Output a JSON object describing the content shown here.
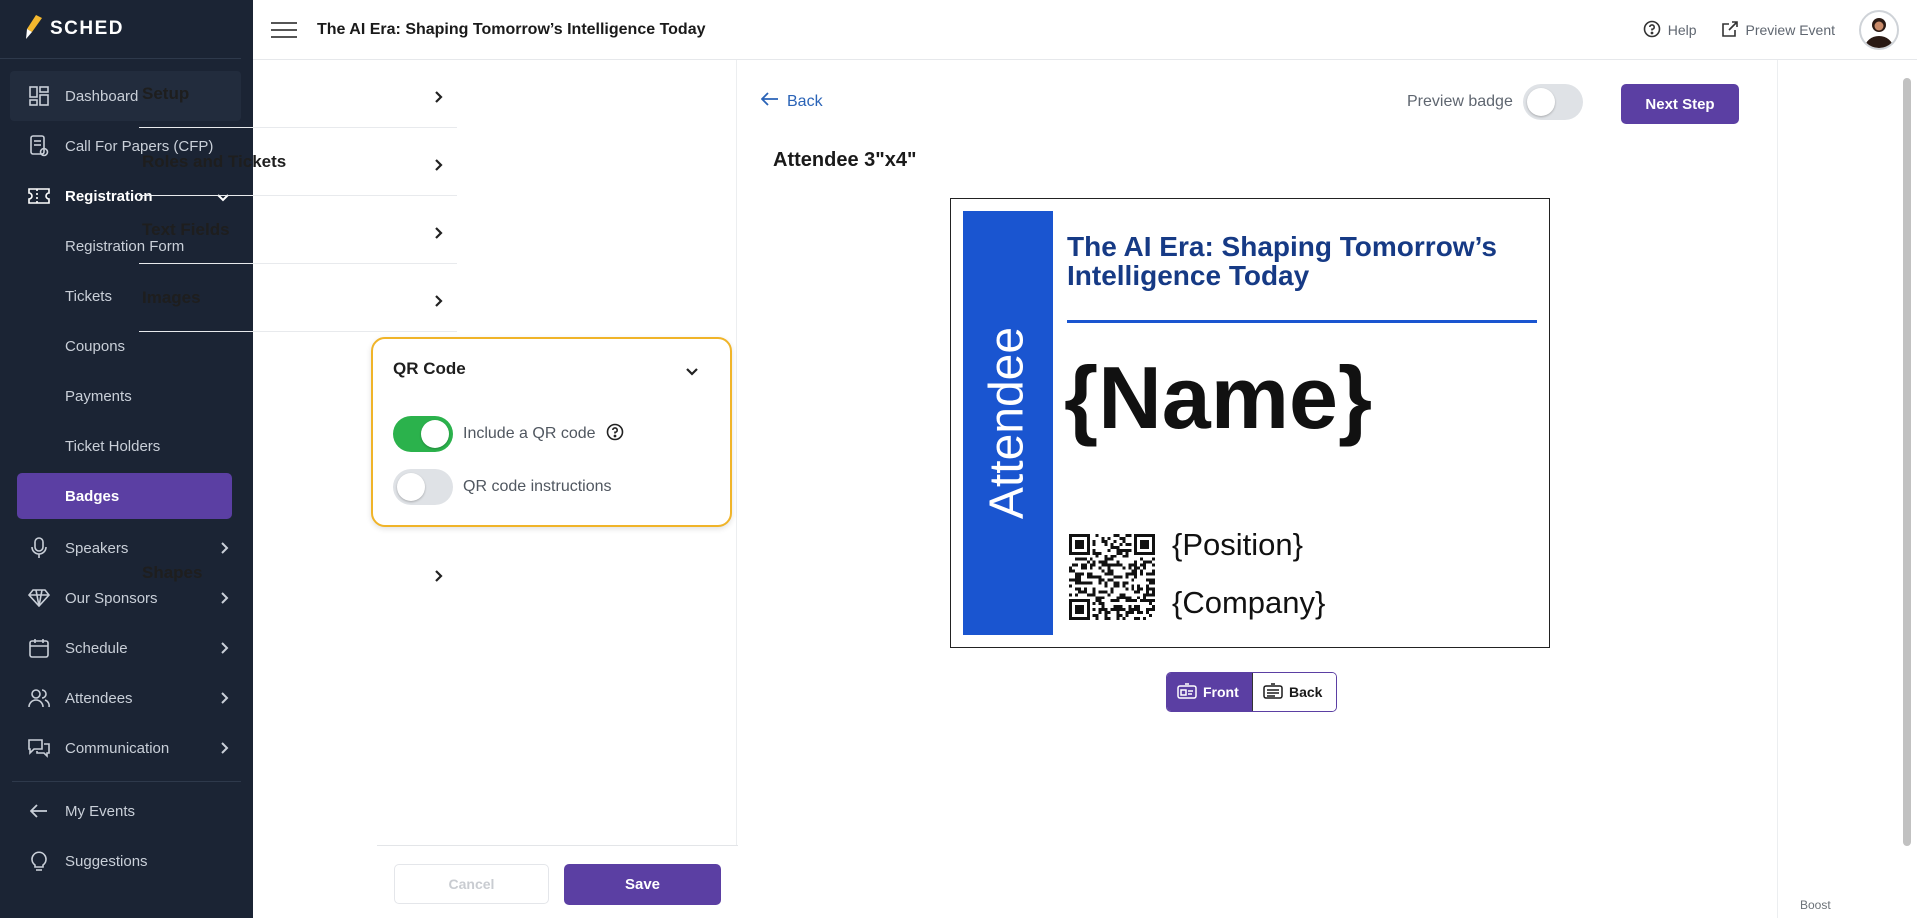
{
  "app": {
    "brand": "SCHED"
  },
  "sidebar": {
    "items": [
      {
        "label": "Dashboard",
        "icon": "dashboard-icon"
      },
      {
        "label": "Call For Papers (CFP)",
        "icon": "cfp-icon"
      },
      {
        "label": "Registration",
        "icon": "ticket-icon"
      }
    ],
    "registration_sub": [
      {
        "label": "Registration Form"
      },
      {
        "label": "Tickets"
      },
      {
        "label": "Coupons"
      },
      {
        "label": "Payments"
      },
      {
        "label": "Ticket Holders"
      },
      {
        "label": "Badges"
      }
    ],
    "items2": [
      {
        "label": "Speakers",
        "icon": "microphone-icon"
      },
      {
        "label": "Our Sponsors",
        "icon": "diamond-icon"
      },
      {
        "label": "Schedule",
        "icon": "calendar-icon"
      },
      {
        "label": "Attendees",
        "icon": "people-icon"
      },
      {
        "label": "Communication",
        "icon": "chat-icon"
      }
    ],
    "bottom": [
      {
        "label": "My Events",
        "icon": "arrow-left-icon"
      },
      {
        "label": "Suggestions",
        "icon": "lightbulb-icon"
      }
    ]
  },
  "header": {
    "event_title": "The AI Era: Shaping Tomorrow’s Intelligence Today",
    "help": "Help",
    "preview_event": "Preview Event"
  },
  "settings": {
    "sections": [
      {
        "label": "Setup"
      },
      {
        "label": "Roles and Tickets"
      },
      {
        "label": "Text Fields"
      },
      {
        "label": "Images"
      }
    ],
    "qr": {
      "label": "QR Code",
      "include_label": "Include a QR code",
      "include_on": true,
      "instructions_label": "QR code instructions",
      "instructions_on": false
    },
    "shapes": {
      "label": "Shapes"
    },
    "cancel": "Cancel",
    "save": "Save"
  },
  "preview": {
    "back": "Back",
    "preview_badge": "Preview badge",
    "preview_badge_on": false,
    "next_step": "Next Step",
    "badge_title": "Attendee 3\"x4\"",
    "badge": {
      "role": "Attendee",
      "event": "The AI Era: Shaping Tomorrow’s Intelligence Today",
      "name": "{Name}",
      "position": "{Position}",
      "company": "{Company}",
      "accent_color": "#1a55d0",
      "event_color": "#163a85"
    },
    "front": "Front",
    "back_side": "Back"
  },
  "footer": {
    "boost": "Boost"
  },
  "colors": {
    "primary": "#5b3fa3",
    "sidebar": "#1b2434",
    "toggle_on": "#2bb24c",
    "highlight": "#f0b429"
  }
}
